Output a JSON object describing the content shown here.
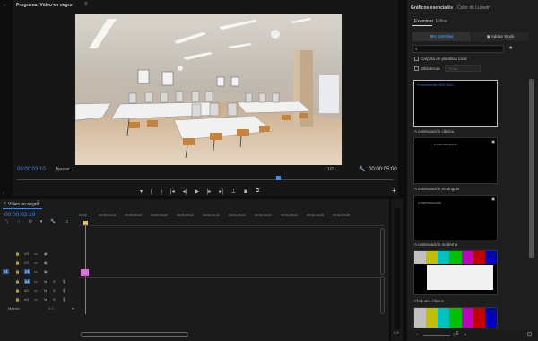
{
  "program": {
    "tab_label": "Programa: Vídeo en negro",
    "timecode_left": "00:00:03:10",
    "fit_label": "Ajustar",
    "resolution": "1/2",
    "timecode_right": "00:00:05:00"
  },
  "timeline": {
    "tab_label": "Vídeo en negro",
    "timecode": "00:00:03:10",
    "ruler": [
      "00:00",
      "00:00:14:23",
      "00:00:29:23",
      "00:00:44:22",
      "00:00:59:22",
      "00:01:14:22",
      "00:01:29:21",
      "00:01:44:21",
      "00:01:59:21",
      "00:02:14:20",
      "00:02:29:20",
      "00:02:44:20"
    ],
    "video_tracks": [
      "V3",
      "V2",
      "V1"
    ],
    "audio_tracks": [
      "A1",
      "A2",
      "A3"
    ],
    "source_patch": "V1",
    "mix_label": "Mezcla",
    "mix_value": "0,0",
    "meter_label": "S S"
  },
  "graphics": {
    "tab_active": "Gráficos esenciales",
    "tab_other": "Color de Lumetri",
    "subtab_browse": "Examinar",
    "subtab_edit": "Editar",
    "btn_my_templates": "Mis plantillas",
    "btn_adobe_stock": "Adobe Stock",
    "local_folder_label": "Carpeta de plantillas local",
    "libraries_label": "Bibliotecas",
    "library_select": "Todas",
    "templates": [
      {
        "label": "A continuación clásico",
        "thumb_text": "Próximamente: INVITADO"
      },
      {
        "label": "A continuación en ángulo",
        "thumb_text": "A CONTINUACIÓN"
      },
      {
        "label": "A continuación moderno",
        "thumb_text": "A CONTINUACIÓN"
      },
      {
        "label": "Claqueta clásica",
        "thumb_text": ""
      },
      {
        "label": "",
        "thumb_text": ""
      }
    ]
  },
  "colors": {
    "accent": "#2d8ceb",
    "clip": "#d873d9",
    "playhead": "#3f8fe8"
  }
}
